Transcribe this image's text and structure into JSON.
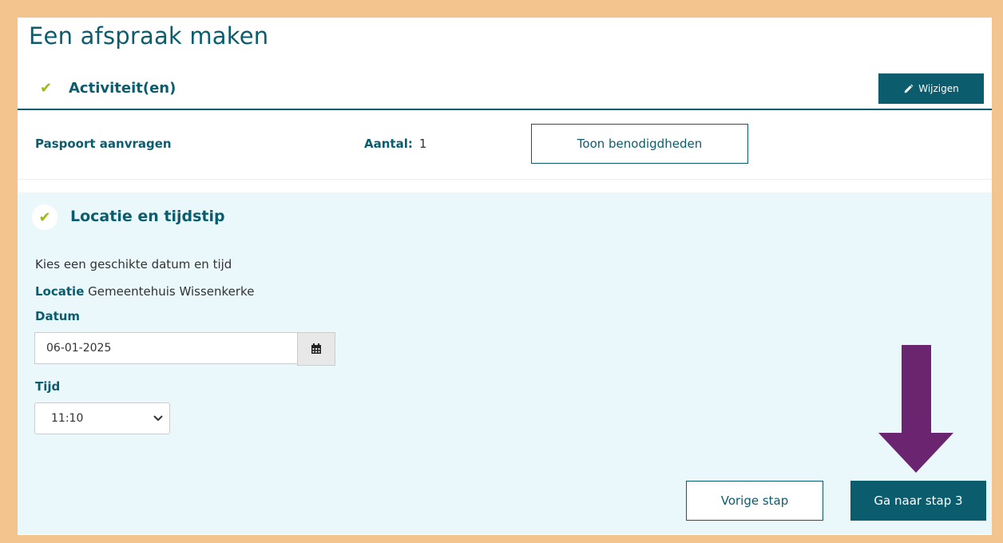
{
  "page": {
    "title": "Een afspraak maken"
  },
  "activities_section": {
    "check_glyph": "✔",
    "title": "Activiteit(en)",
    "edit_button": {
      "icon": "pencil-icon",
      "label": "Wijzigen"
    },
    "items": [
      {
        "name": "Paspoort aanvragen",
        "count_label": "Aantal:",
        "count": "1",
        "requirements_button": "Toon benodigdheden"
      }
    ]
  },
  "location_section": {
    "check_glyph": "✔",
    "title": "Locatie en tijdstip",
    "instruction": "Kies een geschikte datum en tijd",
    "location_label": "Locatie",
    "location_value": "Gemeentehuis Wissenkerke",
    "date_label": "Datum",
    "date_value": "06-01-2025",
    "calendar_icon": "calendar-icon",
    "time_label": "Tijd",
    "time_value": "11:10"
  },
  "navigation": {
    "previous_label": "Vorige stap",
    "next_label": "Ga naar stap 3"
  },
  "colors": {
    "frame": "#f4c48f",
    "primary": "#0b5d6e",
    "check": "#a3b716",
    "section_bg": "#ebf8fb",
    "arrow": "#6a2470"
  }
}
